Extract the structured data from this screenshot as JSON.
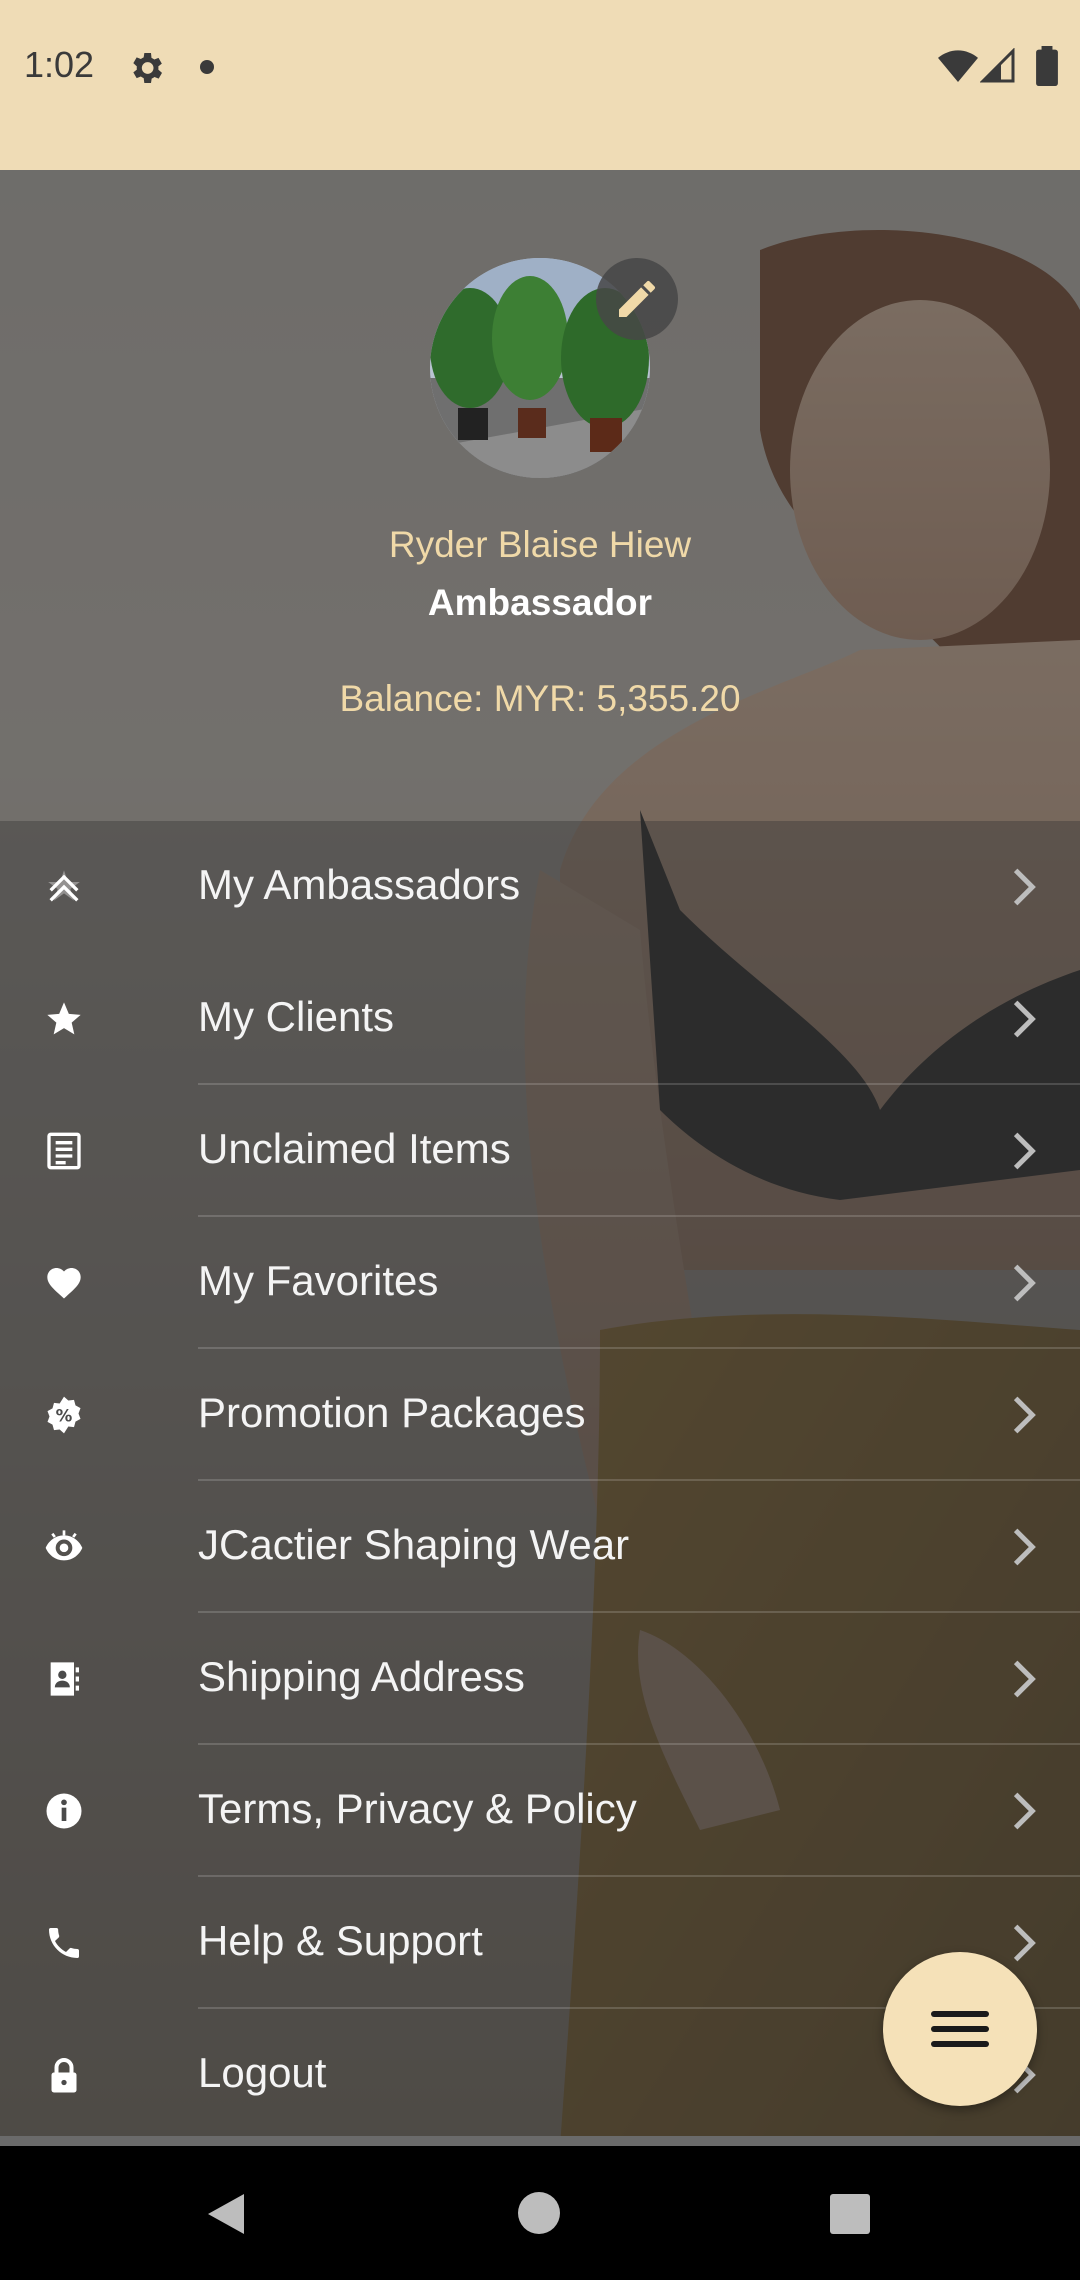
{
  "status_bar": {
    "time": "1:02",
    "icons": [
      "gear-icon",
      "notification-dot-icon",
      "wifi-icon",
      "signal-icon",
      "battery-icon"
    ],
    "background_color": "#efdcb6"
  },
  "profile": {
    "name": "Ryder Blaise Hiew",
    "role": "Ambassador",
    "balance": "Balance: MYR: 5,355.20",
    "edit_icon": "pencil-icon"
  },
  "menu": {
    "items": [
      {
        "label": "My Ambassadors",
        "icon": "ambassador-star-icon"
      },
      {
        "label": "My Clients",
        "icon": "star-icon"
      },
      {
        "label": "Unclaimed Items",
        "icon": "receipt-icon"
      },
      {
        "label": "My Favorites",
        "icon": "heart-icon"
      },
      {
        "label": "Promotion Packages",
        "icon": "percent-badge-icon"
      },
      {
        "label": "JCactier Shaping Wear",
        "icon": "eye-icon"
      },
      {
        "label": "Shipping Address",
        "icon": "address-book-icon"
      },
      {
        "label": "Terms, Privacy & Policy",
        "icon": "info-icon"
      },
      {
        "label": "Help & Support",
        "icon": "phone-icon"
      },
      {
        "label": "Logout",
        "icon": "lock-icon"
      }
    ]
  },
  "fab": {
    "icon": "menu-icon"
  },
  "nav_bar": {
    "icons": [
      "back-icon",
      "home-icon",
      "recents-icon"
    ]
  },
  "colors": {
    "accent": "#f0d9a8",
    "fab_background": "#f5e1b8"
  }
}
